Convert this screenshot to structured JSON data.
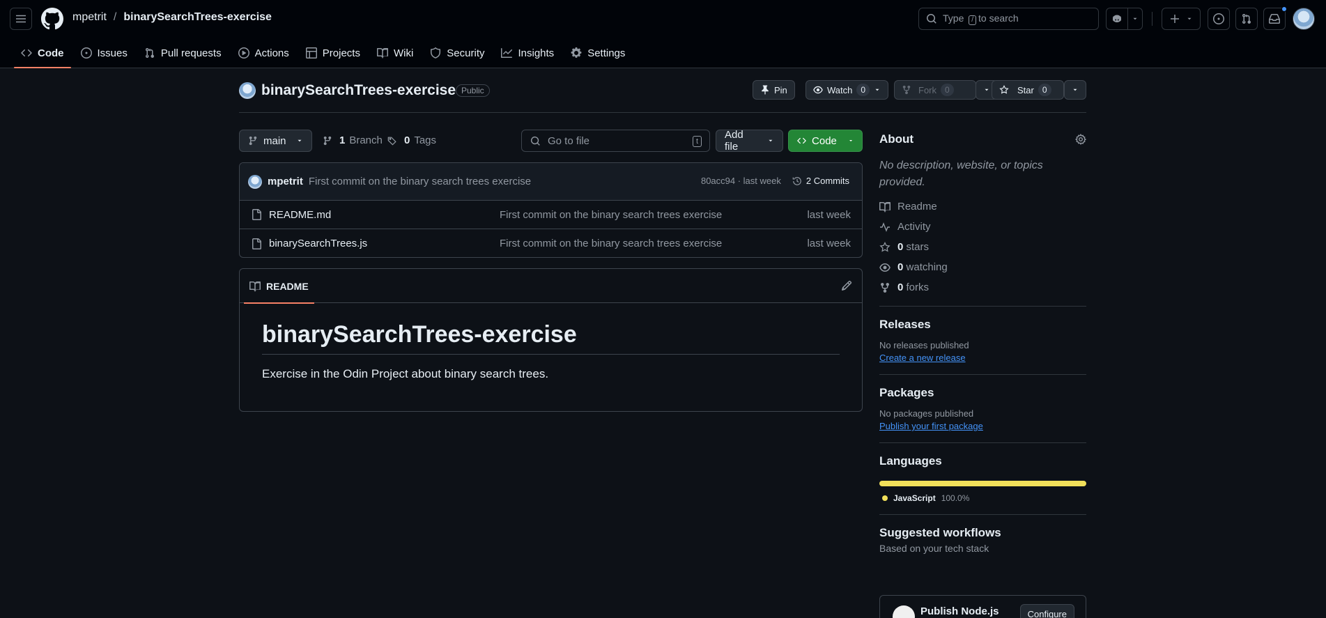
{
  "header": {
    "owner": "mpetrit",
    "separator": "/",
    "repo": "binarySearchTrees-exercise",
    "search_prefix": "Type",
    "search_key": "/",
    "search_suffix": "to search"
  },
  "nav": {
    "tabs": [
      {
        "label": "Code",
        "icon": "code-icon",
        "active": true
      },
      {
        "label": "Issues",
        "icon": "issue-icon"
      },
      {
        "label": "Pull requests",
        "icon": "pull-request-icon"
      },
      {
        "label": "Actions",
        "icon": "play-icon"
      },
      {
        "label": "Projects",
        "icon": "table-icon"
      },
      {
        "label": "Wiki",
        "icon": "book-icon"
      },
      {
        "label": "Security",
        "icon": "shield-icon"
      },
      {
        "label": "Insights",
        "icon": "graph-icon"
      },
      {
        "label": "Settings",
        "icon": "gear-icon"
      }
    ]
  },
  "repo_header": {
    "name": "binarySearchTrees-exercise",
    "visibility": "Public",
    "pin_label": "Pin",
    "watch_label": "Watch",
    "watch_count": "0",
    "fork_label": "Fork",
    "fork_count": "0",
    "star_label": "Star",
    "star_count": "0"
  },
  "toolbar": {
    "branch": "main",
    "branches_count": "1",
    "branches_label": "Branch",
    "tags_count": "0",
    "tags_label": "Tags",
    "goto_placeholder": "Go to file",
    "goto_key": "t",
    "add_file_label": "Add file",
    "code_label": "Code"
  },
  "latest_commit": {
    "author": "mpetrit",
    "message": "First commit on the binary search trees exercise",
    "meta": "80acc94 · last week",
    "commits_label": "2 Commits"
  },
  "files": [
    {
      "name": "README.md",
      "message": "First commit on the binary search trees exercise",
      "time": "last week"
    },
    {
      "name": "binarySearchTrees.js",
      "message": "First commit on the binary search trees exercise",
      "time": "last week"
    }
  ],
  "readme": {
    "tab_label": "README",
    "title": "binarySearchTrees-exercise",
    "body": "Exercise in the Odin Project about binary search trees."
  },
  "sidebar": {
    "about_title": "About",
    "about_desc": "No description, website, or topics provided.",
    "readme_label": "Readme",
    "activity_label": "Activity",
    "stars_count": "0",
    "stars_label": "stars",
    "watching_count": "0",
    "watching_label": "watching",
    "forks_count": "0",
    "forks_label": "forks",
    "releases_title": "Releases",
    "releases_empty": "No releases published",
    "releases_link": "Create a new release",
    "packages_title": "Packages",
    "packages_empty": "No packages published",
    "packages_link": "Publish your first package",
    "languages_title": "Languages",
    "language_name": "JavaScript",
    "language_pct": "100.0%",
    "language_color": "#f1e05a",
    "workflows_title": "Suggested workflows",
    "workflows_sub": "Based on your tech stack",
    "workflow_name": "Publish Node.js",
    "workflow_btn": "Configure"
  },
  "colors": {
    "accent": "#f78166",
    "primary_button": "#238636",
    "link": "#4493f8"
  }
}
